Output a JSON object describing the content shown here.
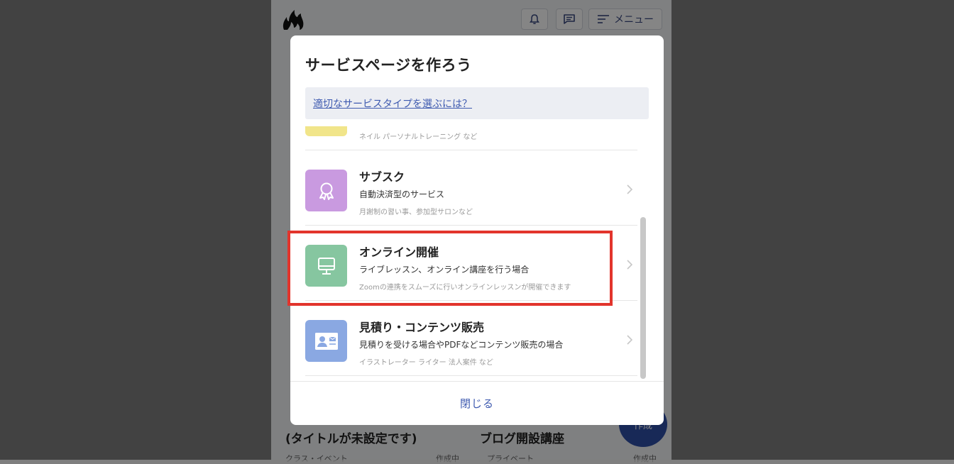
{
  "header": {
    "menu_label": "メニュー"
  },
  "background_cards": [
    {
      "title": "(タイトルが未設定です)",
      "category": "クラス・イベント",
      "status": "作成中"
    },
    {
      "title": "ブログ開設講座",
      "category": "プライベート",
      "status": "作成中"
    }
  ],
  "fab_label": "作成",
  "modal": {
    "title": "サービスページを作ろう",
    "help_link": "適切なサービスタイプを選ぶには？",
    "partial_item_note": "ネイル パーソナルトレーニング など",
    "items": [
      {
        "title": "サブスク",
        "subtitle": "自動決済型のサービス",
        "note": "月謝制の習い事、参加型サロンなど",
        "icon": "award-icon",
        "color": "#c99ae0"
      },
      {
        "title": "オンライン開催",
        "subtitle": "ライブレッスン、オンライン講座を行う場合",
        "note": "Zoomの連携をスムーズに行いオンラインレッスンが開催できます",
        "icon": "monitor-icon",
        "color": "#86c6a0"
      },
      {
        "title": "見積り・コンテンツ販売",
        "subtitle": "見積りを受ける場合やPDFなどコンテンツ販売の場合",
        "note": "イラストレーター ライター 法人案件 など",
        "icon": "contact-card-icon",
        "color": "#8aa8e2"
      }
    ],
    "close_label": "閉じる"
  },
  "colors": {
    "accent": "#3f5bb0",
    "highlight": "#e2342c"
  }
}
